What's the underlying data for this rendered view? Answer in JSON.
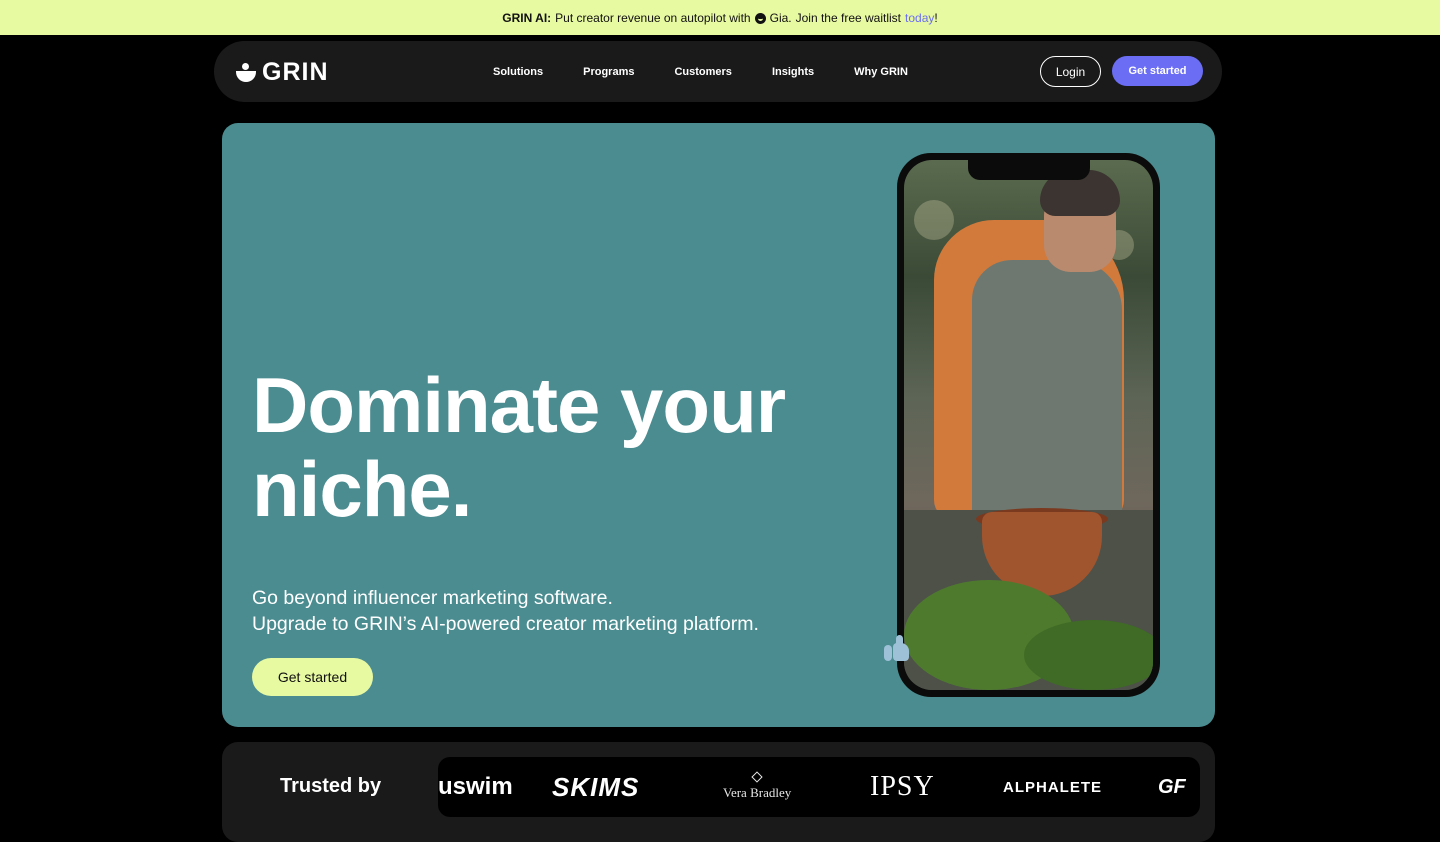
{
  "announcement": {
    "bold": "GRIN AI:",
    "text_before": "Put creator revenue on autopilot with",
    "gia": "Gia.",
    "text_after": "Join the free waitlist",
    "link": "today",
    "end": "!"
  },
  "nav": {
    "logo": "GRIN",
    "items": [
      "Solutions",
      "Programs",
      "Customers",
      "Insights",
      "Why GRIN"
    ],
    "login": "Login",
    "cta": "Get started"
  },
  "hero": {
    "headline_line1": "Dominate your",
    "headline_line2": "niche.",
    "sub_line1": "Go beyond influencer marketing software.",
    "sub_line2": "Upgrade to GRIN’s AI-powered creator marketing platform.",
    "cta": "Get started"
  },
  "trusted": {
    "label": "Trusted by",
    "brands": [
      "uswim",
      "SKIMS",
      "Vera Bradley",
      "IPSY",
      "ALPHALETE",
      "GF"
    ]
  },
  "colors": {
    "announcement_bg": "#e7f9a1",
    "accent": "#6b6ef5",
    "hero_bg": "#4a8c90",
    "nav_bg": "#1a1a1a"
  }
}
